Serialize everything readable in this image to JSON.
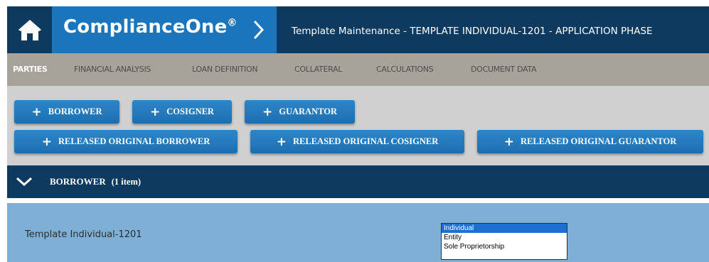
{
  "header": {
    "brand": "ComplianceOne",
    "brand_mark": "®",
    "page_title": "Template Maintenance - TEMPLATE INDIVIDUAL-1201 - APPLICATION PHASE",
    "home_icon": "home-icon",
    "chevron_icon": "chevron-right-icon"
  },
  "nav": {
    "tabs": [
      {
        "label": "PARTIES",
        "active": true
      },
      {
        "label": "FINANCIAL ANALYSIS",
        "active": false
      },
      {
        "label": "LOAN DEFINITION",
        "active": false
      },
      {
        "label": "COLLATERAL",
        "active": false
      },
      {
        "label": "CALCULATIONS",
        "active": false
      },
      {
        "label": "DOCUMENT DATA",
        "active": false
      }
    ]
  },
  "actions": {
    "plus_symbol": "+",
    "buttons": [
      {
        "label": "BORROWER"
      },
      {
        "label": "COSIGNER"
      },
      {
        "label": "GUARANTOR"
      },
      {
        "label": "RELEASED ORIGINAL BORROWER"
      },
      {
        "label": "RELEASED ORIGINAL COSIGNER"
      },
      {
        "label": "RELEASED ORIGINAL GUARANTOR"
      }
    ]
  },
  "section": {
    "title": "BORROWER",
    "count": "(1 item)",
    "expanded": true
  },
  "party": {
    "name": "Template Individual-1201",
    "type_options": [
      "Individual",
      "Entity",
      "Sole Proprietorship"
    ],
    "type_selected": "Individual"
  },
  "colors": {
    "header_dark": "#0d3a5e",
    "brand_blue": "#1b75bc",
    "nav_bg": "#a8a39a",
    "button_blue": "#1b6fb0",
    "row_blue": "#7eb0d6"
  }
}
